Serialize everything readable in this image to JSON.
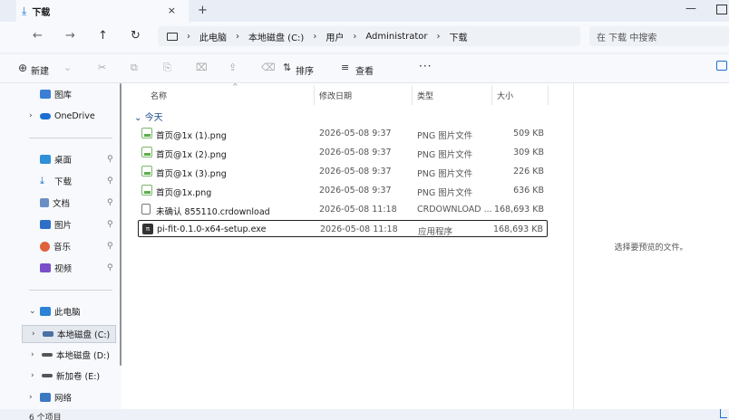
{
  "tab": {
    "title": "下载",
    "close": "×",
    "new": "+"
  },
  "window": {
    "minimize": "—"
  },
  "nav": {
    "back": "←",
    "forward": "→",
    "up": "↑",
    "refresh": "↻"
  },
  "address": {
    "crumbs": [
      "此电脑",
      "本地磁盘 (C:)",
      "用户",
      "Administrator",
      "下载"
    ],
    "sep": "›"
  },
  "search": {
    "placeholder": "在 下载 中搜索"
  },
  "toolbar": {
    "new_label": "新建",
    "new_icon": "⊕",
    "sort_label": "排序",
    "view_label": "查看",
    "more": "···"
  },
  "sidebar": {
    "items": [
      {
        "label": "图库"
      },
      {
        "label": "OneDrive"
      },
      {
        "label": "桌面"
      },
      {
        "label": "下载"
      },
      {
        "label": "文档"
      },
      {
        "label": "图片"
      },
      {
        "label": "音乐"
      },
      {
        "label": "视频"
      },
      {
        "label": "此电脑"
      },
      {
        "label": "本地磁盘 (C:)"
      },
      {
        "label": "本地磁盘 (D:)"
      },
      {
        "label": "新加卷 (E:)"
      },
      {
        "label": "网络"
      }
    ],
    "pin": "⚲"
  },
  "columns": {
    "name": "名称",
    "date": "修改日期",
    "type": "类型",
    "size": "大小"
  },
  "group": {
    "label": "今天"
  },
  "files": [
    {
      "name": "首页@1x (1).png",
      "date": "2026-05-08 9:37",
      "type": "PNG 图片文件",
      "size": "509 KB"
    },
    {
      "name": "首页@1x (2).png",
      "date": "2026-05-08 9:37",
      "type": "PNG 图片文件",
      "size": "309 KB"
    },
    {
      "name": "首页@1x (3).png",
      "date": "2026-05-08 9:37",
      "type": "PNG 图片文件",
      "size": "226 KB"
    },
    {
      "name": "首页@1x.png",
      "date": "2026-05-08 9:37",
      "type": "PNG 图片文件",
      "size": "636 KB"
    },
    {
      "name": "未确认 855110.crdownload",
      "date": "2026-05-08 11:18",
      "type": "CRDOWNLOAD ...",
      "size": "168,693 KB"
    },
    {
      "name": "pi-fit-0.1.0-x64-setup.exe",
      "date": "2026-05-08 11:18",
      "type": "应用程序",
      "size": "168,693 KB"
    }
  ],
  "preview": {
    "message": "选择要预览的文件。"
  },
  "status": {
    "count": "6 个项目"
  },
  "colors": {
    "accent": "#1a6fd1",
    "selection_border": "#222222"
  }
}
